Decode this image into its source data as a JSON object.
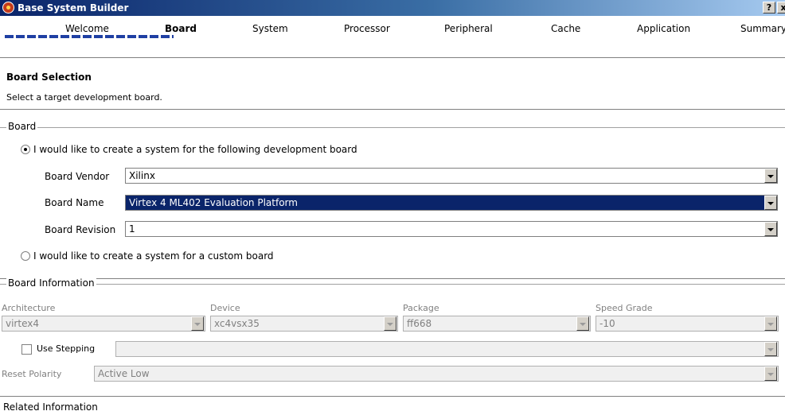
{
  "window": {
    "title": "Base System Builder",
    "help_label": "?",
    "close_label": "x"
  },
  "steps": {
    "items": [
      {
        "label": "Welcome"
      },
      {
        "label": "Board"
      },
      {
        "label": "System"
      },
      {
        "label": "Processor"
      },
      {
        "label": "Peripheral"
      },
      {
        "label": "Cache"
      },
      {
        "label": "Application"
      },
      {
        "label": "Summary"
      }
    ],
    "active": "Board"
  },
  "header": {
    "title": "Board Selection",
    "description": "Select a target development board."
  },
  "board_group": {
    "title": "Board",
    "radio_dev_board": {
      "label": "I would like to create a system for the following development board",
      "checked": true
    },
    "vendor": {
      "label": "Board Vendor",
      "value": "Xilinx"
    },
    "name": {
      "label": "Board Name",
      "value": "Virtex 4 ML402 Evaluation Platform"
    },
    "revision": {
      "label": "Board Revision",
      "value": "1"
    },
    "radio_custom": {
      "label": "I would like to create a system for a custom board",
      "checked": false
    }
  },
  "board_info": {
    "title": "Board Information",
    "architecture": {
      "label": "Architecture",
      "value": "virtex4"
    },
    "device": {
      "label": "Device",
      "value": "xc4vsx35"
    },
    "package": {
      "label": "Package",
      "value": "ff668"
    },
    "speed": {
      "label": "Speed Grade",
      "value": "-10"
    },
    "stepping": {
      "label": "Use Stepping",
      "value": ""
    },
    "reset_polarity": {
      "label": "Reset Polarity",
      "value": "Active Low"
    }
  },
  "related": {
    "label": "Related Information"
  },
  "colors": {
    "title_gradient_start": "#0a246a",
    "progress": "#1f3fa3",
    "selection": "#0a246a"
  }
}
